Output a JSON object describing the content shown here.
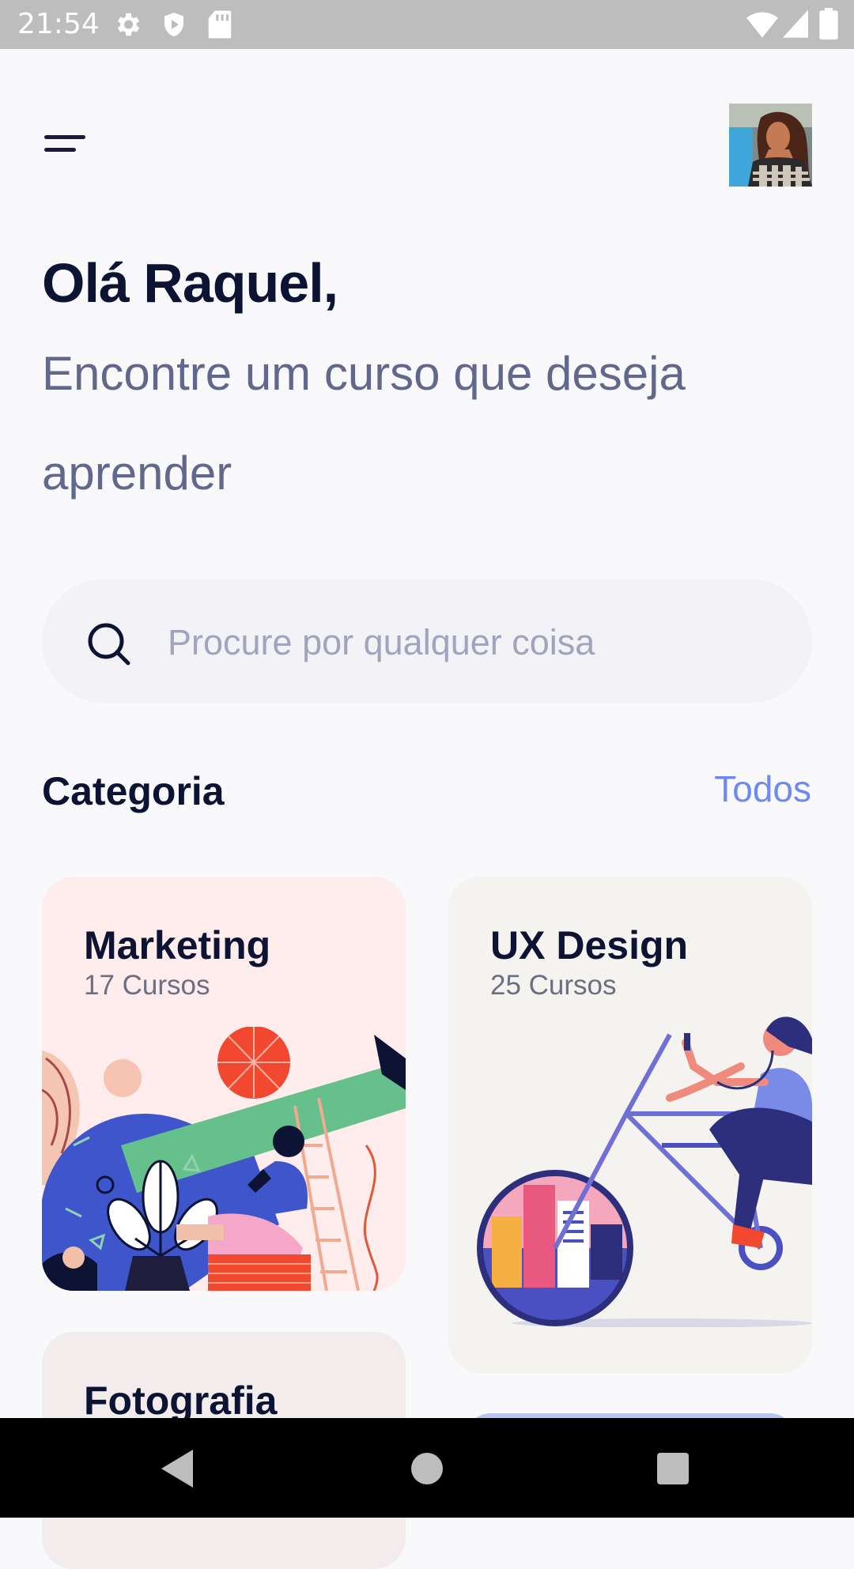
{
  "status_bar": {
    "time": "21:54",
    "icons_left": [
      "gear-icon",
      "shield-icon",
      "sd-card-icon"
    ],
    "icons_right": [
      "wifi-icon",
      "signal-icon",
      "battery-icon"
    ]
  },
  "header": {
    "menu_icon": "menu-icon",
    "avatar": "profile-photo"
  },
  "greeting": {
    "title": "Olá Raquel,",
    "subtitle": "Encontre um curso que deseja aprender"
  },
  "search": {
    "placeholder": "Procure por qualquer coisa",
    "value": "",
    "icon": "search-icon"
  },
  "categories": {
    "title": "Categoria",
    "see_all": "Todos",
    "items": [
      {
        "title": "Marketing",
        "count": "17 Cursos",
        "color": "#ffeced"
      },
      {
        "title": "UX Design",
        "count": "25 Cursos",
        "color": "#f4f3f0"
      },
      {
        "title": "Fotografia",
        "count": "",
        "color": "#f3ecec"
      }
    ]
  },
  "nav_bar": {
    "buttons": [
      "back-icon",
      "home-icon",
      "recents-icon"
    ]
  },
  "colors": {
    "accent": "#6e8af0",
    "heading": "#0d1333",
    "subtitle": "#61688b",
    "background": "#f9f9fb"
  }
}
